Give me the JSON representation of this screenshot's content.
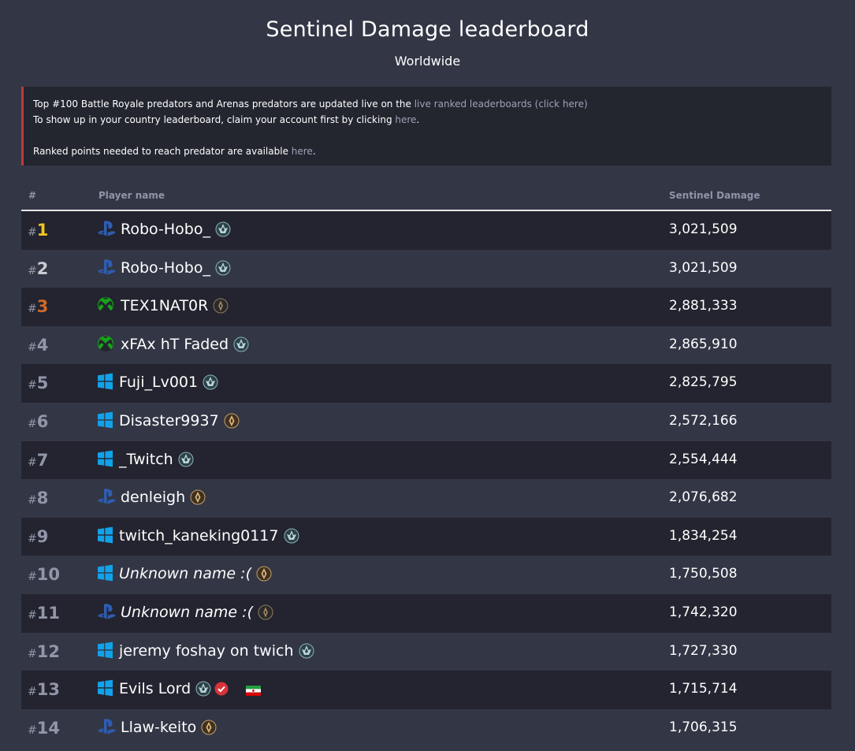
{
  "header": {
    "title": "Sentinel Damage leaderboard",
    "subtitle": "Worldwide"
  },
  "notice": {
    "line1_text": "Top #100 Battle Royale predators and Arenas predators are updated live on the ",
    "line1_link": "live ranked leaderboards (click here)",
    "line2_text": "To show up in your country leaderboard, claim your account first by clicking ",
    "line2_link": "here",
    "line2_end": ".",
    "line3_text": "Ranked points needed to reach predator are available ",
    "line3_link": "here",
    "line3_end": "."
  },
  "table": {
    "columns": {
      "rank": "#",
      "player": "Player name",
      "value": "Sentinel Damage"
    },
    "rows": [
      {
        "hash": "#",
        "rank": "1",
        "medal": "gold",
        "platform": "playstation",
        "name": "Robo-Hobo_",
        "unknown": false,
        "badge": "teal-rank-badge",
        "value": "3,021,509"
      },
      {
        "hash": "#",
        "rank": "2",
        "medal": "silver",
        "platform": "playstation",
        "name": "Robo-Hobo_",
        "unknown": false,
        "badge": "teal-rank-badge",
        "value": "3,021,509"
      },
      {
        "hash": "#",
        "rank": "3",
        "medal": "bronze",
        "platform": "xbox",
        "name": "TEX1NAT0R",
        "unknown": false,
        "badge": "dark-rank-badge",
        "value": "2,881,333"
      },
      {
        "hash": "#",
        "rank": "4",
        "medal": "",
        "platform": "xbox",
        "name": "xFAx hT Faded",
        "unknown": false,
        "badge": "teal-rank-badge",
        "value": "2,865,910"
      },
      {
        "hash": "#",
        "rank": "5",
        "medal": "",
        "platform": "windows",
        "name": "Fuji_Lv001",
        "unknown": false,
        "badge": "teal-rank-badge",
        "value": "2,825,795"
      },
      {
        "hash": "#",
        "rank": "6",
        "medal": "",
        "platform": "windows",
        "name": "Disaster9937",
        "unknown": false,
        "badge": "bronze-rank-badge",
        "value": "2,572,166"
      },
      {
        "hash": "#",
        "rank": "7",
        "medal": "",
        "platform": "windows",
        "name": "_Twitch",
        "unknown": false,
        "badge": "teal-rank-badge",
        "value": "2,554,444"
      },
      {
        "hash": "#",
        "rank": "8",
        "medal": "",
        "platform": "playstation",
        "name": "denleigh",
        "unknown": false,
        "badge": "bronze-rank-badge",
        "value": "2,076,682"
      },
      {
        "hash": "#",
        "rank": "9",
        "medal": "",
        "platform": "windows",
        "name": "twitch_kaneking0117",
        "unknown": false,
        "badge": "teal-rank-badge",
        "value": "1,834,254"
      },
      {
        "hash": "#",
        "rank": "10",
        "medal": "",
        "platform": "windows",
        "name": "Unknown name :(",
        "unknown": true,
        "badge": "bronze-rank-badge",
        "value": "1,750,508"
      },
      {
        "hash": "#",
        "rank": "11",
        "medal": "",
        "platform": "playstation",
        "name": "Unknown name :(",
        "unknown": true,
        "badge": "dark-rank-badge",
        "value": "1,742,320"
      },
      {
        "hash": "#",
        "rank": "12",
        "medal": "",
        "platform": "windows",
        "name": "jeremy foshay on twich",
        "unknown": false,
        "badge": "teal-rank-badge",
        "value": "1,727,330"
      },
      {
        "hash": "#",
        "rank": "13",
        "medal": "",
        "platform": "windows",
        "name": "Evils Lord",
        "unknown": false,
        "badge": "teal-rank-badge",
        "verified": true,
        "flag": "iran",
        "value": "1,715,714"
      },
      {
        "hash": "#",
        "rank": "14",
        "medal": "",
        "platform": "playstation",
        "name": "Llaw-keito",
        "unknown": false,
        "badge": "bronze-rank-badge",
        "value": "1,706,315"
      }
    ]
  },
  "colors": {
    "background": "#333645",
    "row_alt": "#23242f",
    "notice_border": "#c0393b",
    "link": "#9ea3b6",
    "gold": "#f2c522",
    "silver": "#c9cbd3",
    "bronze": "#d16a28",
    "playstation": "#2f5db0",
    "xbox": "#17a21a",
    "windows": "#11a2e9"
  }
}
